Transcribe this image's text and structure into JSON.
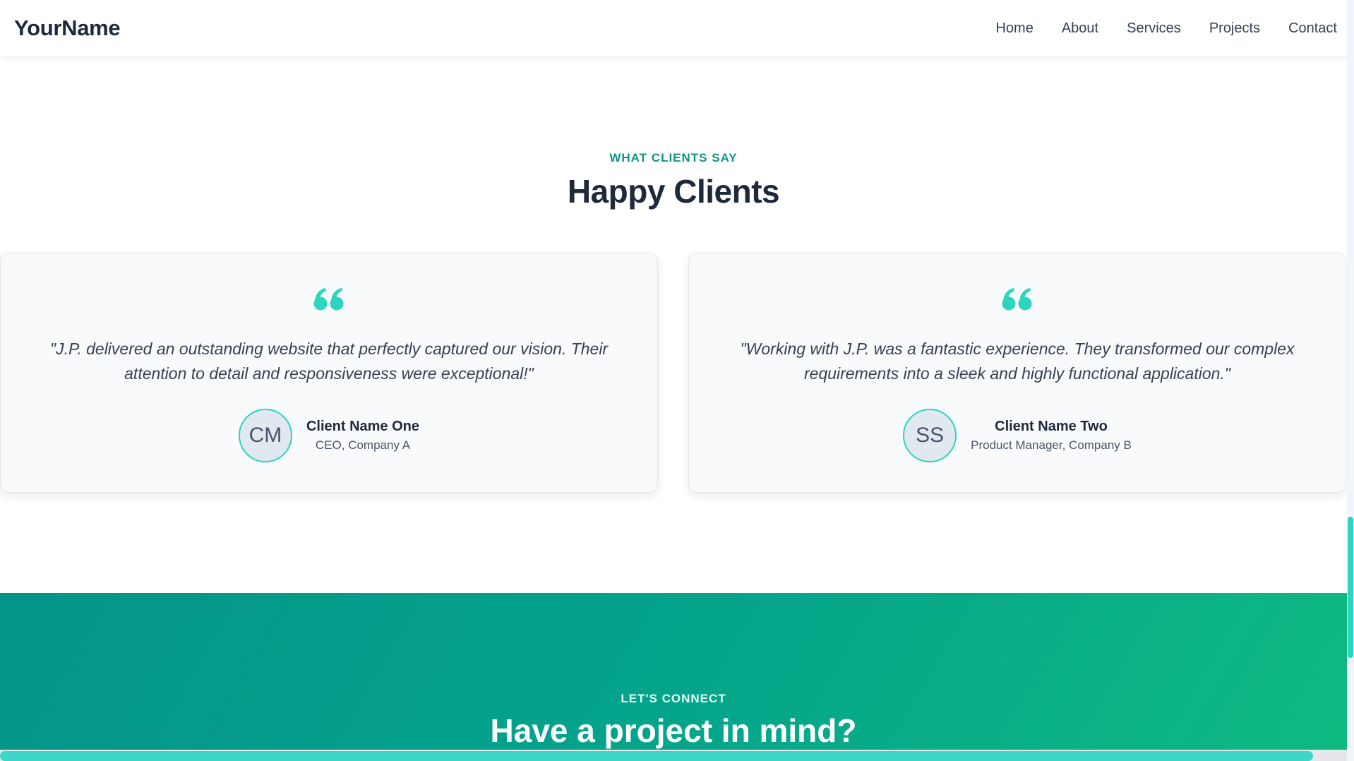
{
  "header": {
    "brand": "YourName",
    "nav": [
      "Home",
      "About",
      "Services",
      "Projects",
      "Contact"
    ]
  },
  "testimonials": {
    "eyebrow": "WHAT CLIENTS SAY",
    "title": "Happy Clients",
    "items": [
      {
        "quote": "\"J.P. delivered an outstanding website that perfectly captured our vision. Their attention to detail and responsiveness were exceptional!\"",
        "initials": "CM",
        "name": "Client Name One",
        "role": "CEO, Company A"
      },
      {
        "quote": "\"Working with J.P. was a fantastic experience. They transformed our complex requirements into a sleek and highly functional application.\"",
        "initials": "SS",
        "name": "Client Name Two",
        "role": "Product Manager, Company B"
      }
    ]
  },
  "contact": {
    "eyebrow": "LET'S CONNECT",
    "title": "Have a project in mind?"
  },
  "colors": {
    "accent": "#0d9488",
    "quote_icon": "#2dd4bf",
    "band_start": "#059488",
    "band_end": "#10b981"
  },
  "icons": {
    "quote": "quote-icon"
  }
}
